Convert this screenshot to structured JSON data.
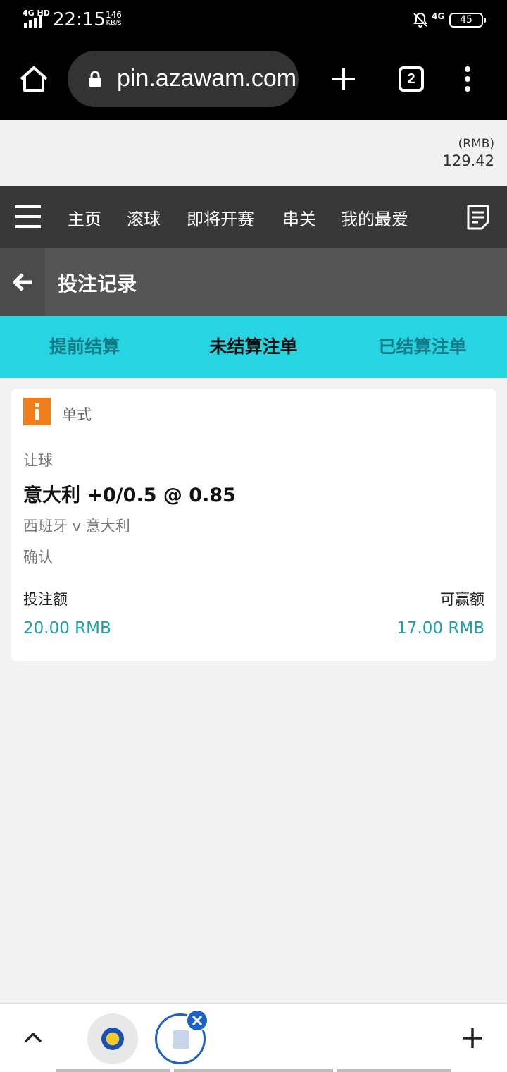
{
  "status_bar": {
    "network": "4G HD",
    "time": "22:15",
    "speed_value": "146",
    "speed_unit": "KB/s",
    "mobile_network": "4G",
    "battery": "45"
  },
  "browser": {
    "url": "pin.azawam.com",
    "tab_count": "2"
  },
  "balance": {
    "currency": "(RMB)",
    "amount": "129.42"
  },
  "nav": {
    "items": [
      "主页",
      "滚球",
      "即将开赛",
      "串关",
      "我的最爱"
    ]
  },
  "page": {
    "title": "投注记录"
  },
  "tabs": [
    {
      "label": "提前结算",
      "active": false
    },
    {
      "label": "未结算注单",
      "active": true
    },
    {
      "label": "已结算注单",
      "active": false
    }
  ],
  "bet": {
    "type": "单式",
    "market": "让球",
    "selection": "意大利 +0/0.5 @ 0.85",
    "match": "西班牙 v 意大利",
    "status": "确认",
    "stake_label": "投注额",
    "stake_value": "20.00 RMB",
    "win_label": "可赢额",
    "win_value": "17.00 RMB"
  },
  "colors": {
    "accent": "#27d4e1",
    "value_text": "#1aa2ad",
    "badge": "#f07e1f",
    "nav_bg": "#383838"
  }
}
